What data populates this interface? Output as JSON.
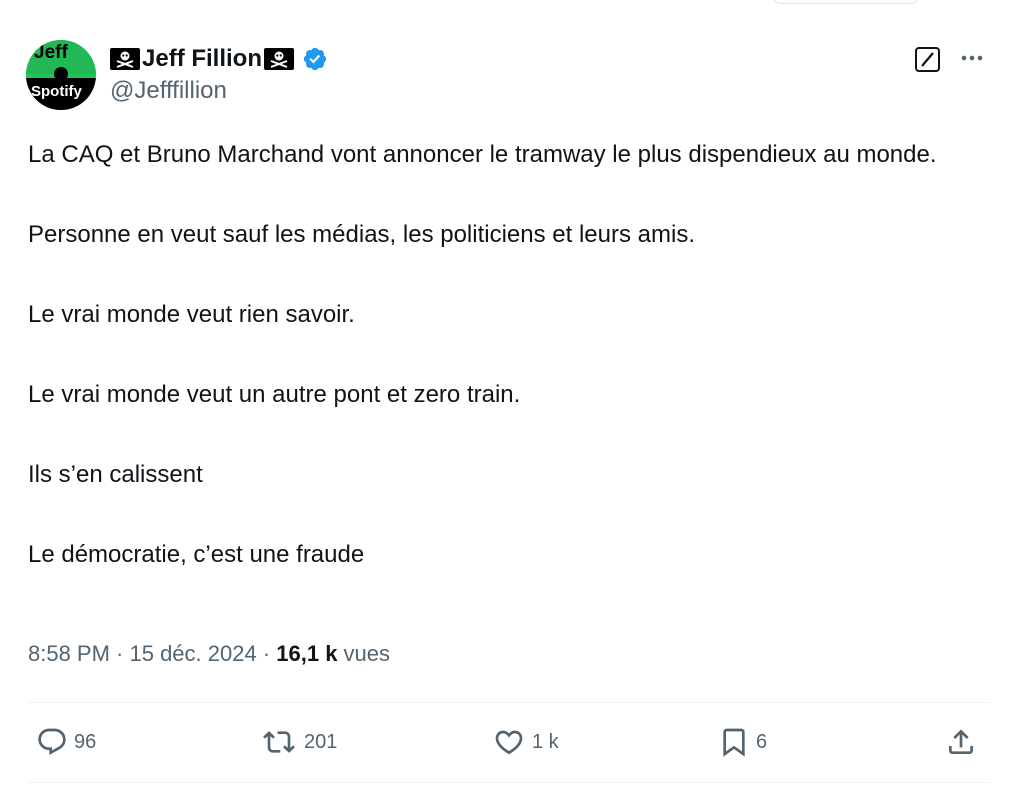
{
  "author": {
    "display_name": "Jeff Fillion",
    "handle": "@Jefffillion",
    "verified": true,
    "avatar_text_top": "Jeff",
    "avatar_text_bottom": "Spotify"
  },
  "tweet": {
    "paragraphs": [
      "La CAQ et Bruno Marchand vont annoncer le tramway le plus dispendieux au monde.",
      "Personne en veut sauf les médias, les politiciens et leurs amis.",
      "Le vrai monde veut rien savoir.",
      "Le vrai monde veut un autre pont et zero train.",
      "Ils s’en calissent",
      "Le démocratie, c’est une fraude"
    ]
  },
  "meta": {
    "time_date": "8:58 PM · 15 déc. 2024 · ",
    "views_count": "16,1 k",
    "views_label": " vues"
  },
  "actions": {
    "replies": "96",
    "reposts": "201",
    "likes": "1 k",
    "bookmarks": "6"
  },
  "icons": {
    "reply": "reply-icon",
    "repost": "repost-icon",
    "like": "heart-icon",
    "bookmark": "bookmark-icon",
    "share": "share-icon",
    "more": "more-icon",
    "grok": "grok-icon",
    "verified": "verified-badge-icon"
  },
  "colors": {
    "text": "#0f1419",
    "secondary": "#536471",
    "verified_blue": "#1d9bf0",
    "avatar_green": "#20b955"
  }
}
